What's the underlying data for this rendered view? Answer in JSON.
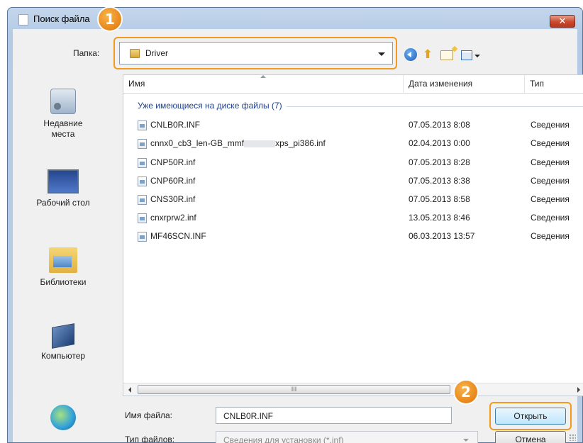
{
  "window": {
    "title": "Поиск файла",
    "close_label": "✕"
  },
  "toolbar": {
    "folder_label": "Папка:",
    "folder_value": "Driver",
    "icons": [
      "back-icon",
      "up-folder-icon",
      "new-folder-icon",
      "view-menu-icon"
    ]
  },
  "sidebar": {
    "items": [
      {
        "label": "Недавние места",
        "icon": "recent-places-icon"
      },
      {
        "label": "Рабочий стол",
        "icon": "desktop-icon"
      },
      {
        "label": "Библиотеки",
        "icon": "libraries-icon"
      },
      {
        "label": "Компьютер",
        "icon": "computer-icon"
      },
      {
        "label": "",
        "icon": "network-icon"
      }
    ]
  },
  "filelist": {
    "columns": {
      "name": "Имя",
      "date": "Дата изменения",
      "type": "Тип"
    },
    "group_label": "Уже имеющиеся на диске файлы (7)",
    "rows": [
      {
        "name": "CNLB0R.INF",
        "date": "07.05.2013 8:08",
        "type": "Сведения"
      },
      {
        "name_pre": "cnnx0_cb3_len-GB_mmf",
        "name_post": "xps_pi386.inf",
        "date": "02.04.2013 0:00",
        "type": "Сведения"
      },
      {
        "name": "CNP50R.inf",
        "date": "07.05.2013 8:28",
        "type": "Сведения"
      },
      {
        "name": "CNP60R.inf",
        "date": "07.05.2013 8:38",
        "type": "Сведения"
      },
      {
        "name": "CNS30R.inf",
        "date": "07.05.2013 8:58",
        "type": "Сведения"
      },
      {
        "name": "cnxrprw2.inf",
        "date": "13.05.2013 8:46",
        "type": "Сведения"
      },
      {
        "name": "MF46SCN.INF",
        "date": "06.03.2013 13:57",
        "type": "Сведения"
      }
    ],
    "scroll_thumb_grip": "III"
  },
  "bottom": {
    "filename_label": "Имя файла:",
    "filename_value": "CNLB0R.INF",
    "filetype_label": "Тип файлов:",
    "filetype_value": "Сведения для установки (*.inf)",
    "open_label": "Открыть",
    "cancel_label": "Отмена"
  },
  "callouts": {
    "one": "1",
    "two": "2"
  },
  "colors": {
    "accent": "#f29a1e",
    "group_label": "#1e3f8f"
  }
}
